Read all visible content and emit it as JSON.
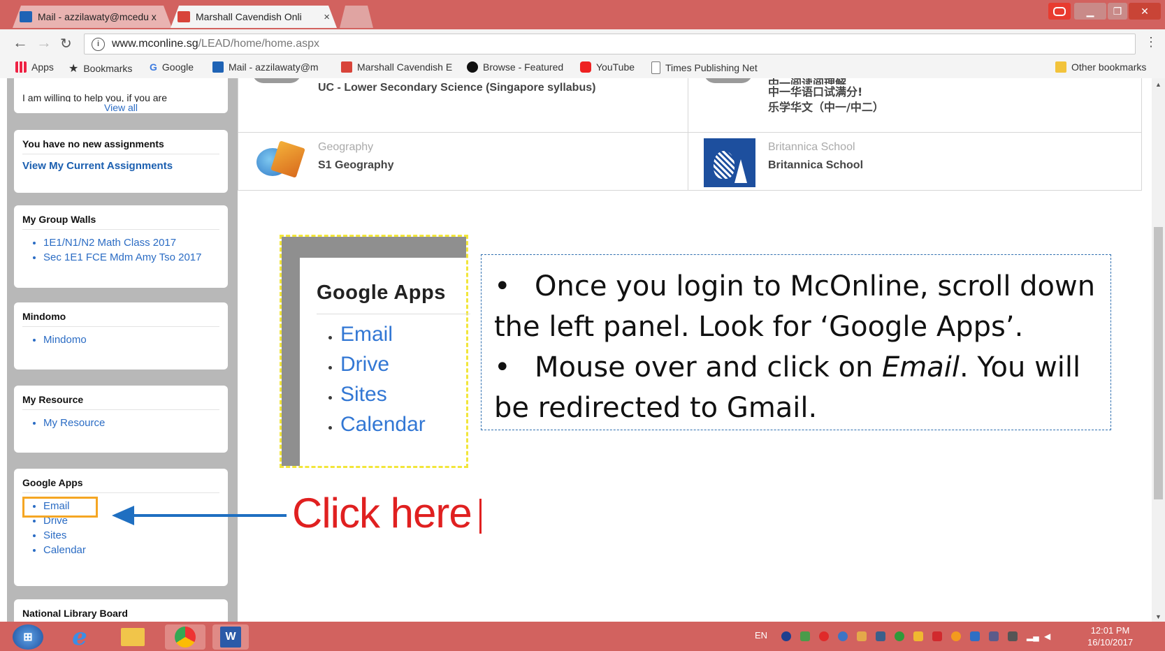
{
  "tabs": [
    {
      "label": "Mail - azzilawaty@mcedu x",
      "close": "×"
    },
    {
      "label": "Marshall Cavendish Onli",
      "close": "×"
    }
  ],
  "address": {
    "host": "www.mconline.sg",
    "path": "/LEAD/home/home.aspx"
  },
  "bookmarks": [
    {
      "label": "Apps"
    },
    {
      "label": "Bookmarks"
    },
    {
      "label": "Google"
    },
    {
      "label": "Mail - azzilawaty@m"
    },
    {
      "label": "Marshall Cavendish E"
    },
    {
      "label": "Browse - Featured"
    },
    {
      "label": "YouTube"
    },
    {
      "label": "Times Publishing Net"
    }
  ],
  "other_bookmarks": "Other bookmarks",
  "left_panel": {
    "partial_text": "I am willing to help you, if you are",
    "view_all": "View all",
    "assignments": {
      "title": "You have no new assignments",
      "link": "View My Current Assignments"
    },
    "group_walls": {
      "title": "My Group Walls",
      "items": [
        "1E1/N1/N2 Math Class 2017",
        "Sec 1E1 FCE Mdm Amy Tso 2017"
      ]
    },
    "mindomo": {
      "title": "Mindomo",
      "items": [
        "Mindomo"
      ]
    },
    "my_resource": {
      "title": "My Resource",
      "items": [
        "My Resource"
      ]
    },
    "google_apps": {
      "title": "Google Apps",
      "items": [
        "Email",
        "Drive",
        "Sites",
        "Calendar"
      ]
    },
    "nlb": {
      "title": "National Library Board"
    }
  },
  "courses": {
    "top_left": "UC - Lower Secondary Science (Singapore syllabus)",
    "top_right_lines": [
      "中一阅读阅理解",
      "中一华语口试满分!",
      "乐学华文（中一/中二）"
    ],
    "geography": {
      "category": "Geography",
      "name": "S1 Geography"
    },
    "britannica": {
      "category": "Britannica School",
      "name": "Britannica School"
    }
  },
  "zoom_inset": {
    "title": "Google Apps",
    "items": [
      "Email",
      "Drive",
      "Sites",
      "Calendar"
    ]
  },
  "callout": {
    "line1": "Once you login to McOnline,  scroll down the left panel. Look for ‘Google Apps’.",
    "line2_pre": "Mouse over and click on ",
    "line2_em": "Email",
    "line2_post": ". You will be redirected to Gmail."
  },
  "click_here": "Click here",
  "taskbar": {
    "lang": "EN",
    "time": "12:01 PM",
    "date": "16/10/2017"
  },
  "colors": {
    "chrome_frame": "#d2625f",
    "link_blue": "#2b6cc4",
    "highlight_box": "#f5a623",
    "arrow": "#1f6fc1",
    "click_here": "#e02020"
  }
}
